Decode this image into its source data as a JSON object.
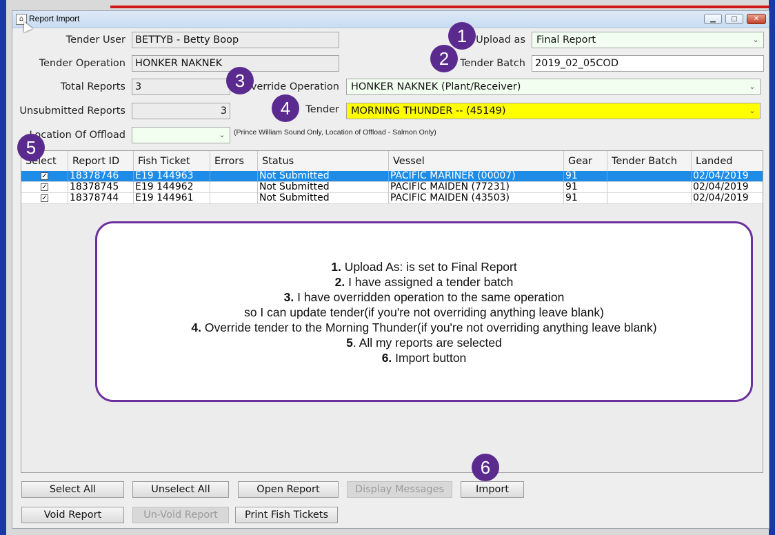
{
  "window": {
    "title": "Report Import",
    "minimize": "▁",
    "maximize": "▢",
    "close": "✕",
    "app_icon": "⌂"
  },
  "form": {
    "tender_user_label": "Tender User",
    "tender_user_value": "BETTYB - Betty Boop",
    "tender_operation_label": "Tender Operation",
    "tender_operation_value": "HONKER NAKNEK",
    "total_reports_label": "Total Reports",
    "total_reports_value": "3",
    "unsubmitted_reports_label": "Unsubmitted Reports",
    "unsubmitted_reports_value": "3",
    "location_offload_label": "Location Of Offload",
    "location_offload_value": "",
    "location_note": "(Prince William Sound Only, Location of Offload - Salmon Only)",
    "upload_as_label": "Upload as",
    "upload_as_value": "Final Report",
    "tender_batch_label": "Tender Batch",
    "tender_batch_value": "2019_02_05COD",
    "override_operation_label": "Override Operation",
    "override_operation_value": "HONKER NAKNEK (Plant/Receiver)",
    "tender_label": "Tender",
    "tender_value": "MORNING THUNDER -- (45149)",
    "dropdown_arrow": "⌄"
  },
  "table": {
    "columns": [
      "Select",
      "Report ID",
      "Fish Ticket",
      "Errors",
      "Status",
      "Vessel",
      "Gear",
      "Tender Batch",
      "Landed"
    ],
    "rows": [
      {
        "checked": "✓",
        "report_id": "18378746",
        "fish_ticket": "E19 144963",
        "errors": "",
        "status": "Not Submitted",
        "vessel": "PACIFIC MARINER (00007)",
        "gear": "91",
        "tender_batch": "",
        "landed": "02/04/2019"
      },
      {
        "checked": "✓",
        "report_id": "18378745",
        "fish_ticket": "E19 144962",
        "errors": "",
        "status": "Not Submitted",
        "vessel": "PACIFIC MAIDEN (77231)",
        "gear": "91",
        "tender_batch": "",
        "landed": "02/04/2019"
      },
      {
        "checked": "✓",
        "report_id": "18378744",
        "fish_ticket": "E19 144961",
        "errors": "",
        "status": "Not Submitted",
        "vessel": "PACIFIC MAIDEN (43503)",
        "gear": "91",
        "tender_batch": "",
        "landed": "02/04/2019"
      }
    ]
  },
  "buttons": {
    "select_all": "Select All",
    "unselect_all": "Unselect All",
    "open_report": "Open Report",
    "display_messages": "Display Messages",
    "import": "Import",
    "void_report": "Void Report",
    "unvoid_report": "Un-Void Report",
    "print_fish_tickets": "Print Fish Tickets"
  },
  "annotations": {
    "badges": [
      "1",
      "2",
      "3",
      "4",
      "5",
      "6"
    ],
    "callout": {
      "l1_num": "1.",
      "l1": " Upload As: is set to Final Report",
      "l2_num": "2.",
      "l2": " I have assigned a tender batch",
      "l3_num": "3.",
      "l3": " I have overridden operation to the same operation",
      "l4": "so I can update tender(if you're not overriding anything leave blank)",
      "l5_num": "4.",
      "l5": " Override tender to the Morning Thunder(if you're not overriding anything leave blank)",
      "l6_num": "5",
      "l6": ". All my reports are selected",
      "l7_num": "6.",
      "l7": " Import button"
    }
  },
  "colors": {
    "selected_row": "#1e8ce6",
    "tender_highlight": "#ffff00",
    "badge": "#5b2a8e",
    "combo_bg": "#f2fff0"
  }
}
